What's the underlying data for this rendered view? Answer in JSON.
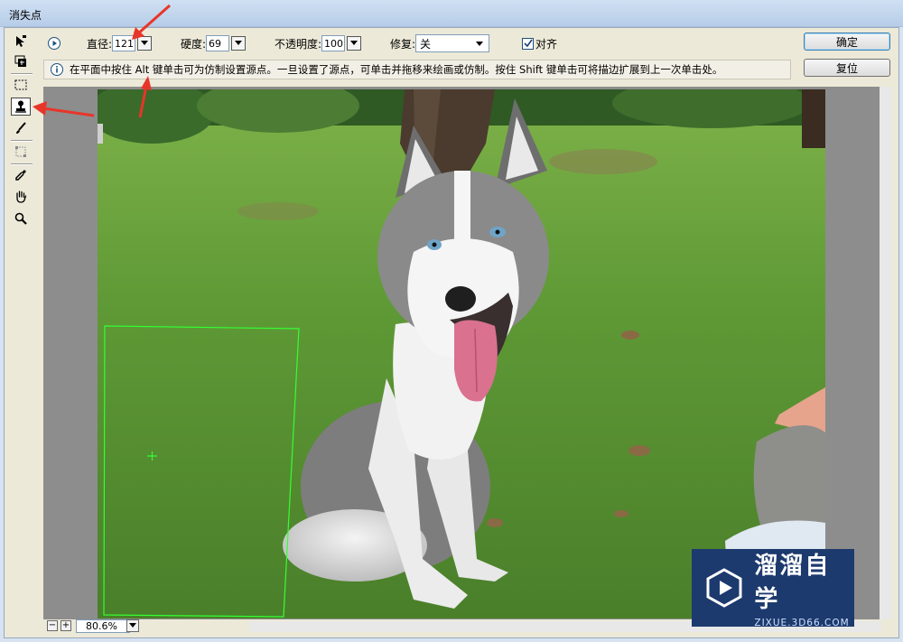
{
  "window": {
    "title": "消失点"
  },
  "tools": [
    {
      "name": "edit-plane-tool-icon"
    },
    {
      "name": "create-plane-tool-icon"
    },
    {
      "name": "marquee-tool-icon"
    },
    {
      "name": "stamp-tool-icon",
      "active": true
    },
    {
      "name": "brush-tool-icon"
    },
    {
      "name": "transform-tool-icon"
    },
    {
      "name": "eyedropper-tool-icon"
    },
    {
      "name": "hand-tool-icon"
    },
    {
      "name": "zoom-tool-icon"
    }
  ],
  "options": {
    "diameter_label": "直径:",
    "diameter_value": "121",
    "hardness_label": "硬度:",
    "hardness_value": "69",
    "opacity_label": "不透明度:",
    "opacity_value": "100",
    "heal_label": "修复:",
    "heal_value": "关",
    "align_label": "对齐",
    "align_checked": true
  },
  "buttons": {
    "ok": "确定",
    "reset": "复位"
  },
  "info": {
    "text": "在平面中按住 Alt 键单击可为仿制设置源点。一旦设置了源点，可单击并拖移来绘画或仿制。按住 Shift 键单击可将描边扩展到上一次单击处。"
  },
  "zoom": {
    "value": "80.6%",
    "minus": "−",
    "plus": "+"
  },
  "logo": {
    "main": "溜溜自学",
    "sub": "ZIXUE.3D66.COM"
  },
  "colors": {
    "annotation_arrow": "#e8352a",
    "plane_outline": "#33ff33",
    "logo_bg": "#1d3a6e"
  }
}
